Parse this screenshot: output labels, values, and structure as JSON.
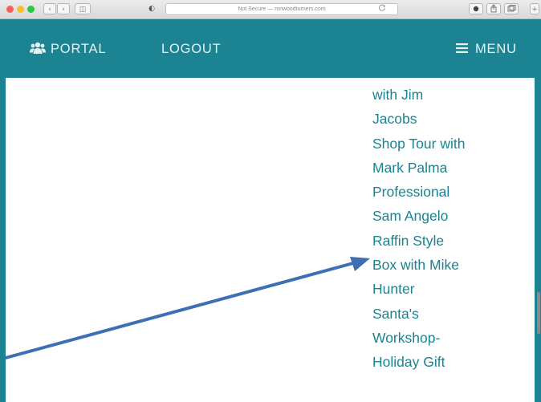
{
  "browser": {
    "url_text": "Not Secure — mnwoodturners.com",
    "icons": [
      "close-icon",
      "minimize-icon",
      "zoom-icon",
      "back-icon",
      "forward-icon",
      "sidebar-icon",
      "privacy-shield-icon",
      "reload-icon",
      "extension-icon",
      "share-icon",
      "tabs-icon",
      "new-tab-icon"
    ]
  },
  "nav": {
    "portal_label": "PORTAL",
    "logout_label": "LOGOUT",
    "menu_label": "MENU",
    "icons": [
      "users-icon",
      "hamburger-icon"
    ]
  },
  "list": {
    "lines": [
      "with Jim",
      "Jacobs",
      "Shop Tour with",
      "Mark Palma",
      "Professional",
      "Sam Angelo",
      "Raffin Style",
      "Box with Mike",
      "Hunter",
      "Santa's",
      "Workshop-",
      "Holiday Gift"
    ]
  },
  "colors": {
    "brand_teal": "#1b8391",
    "arrow_blue": "#3e6fb4",
    "nav_text": "#e6f3f4"
  }
}
